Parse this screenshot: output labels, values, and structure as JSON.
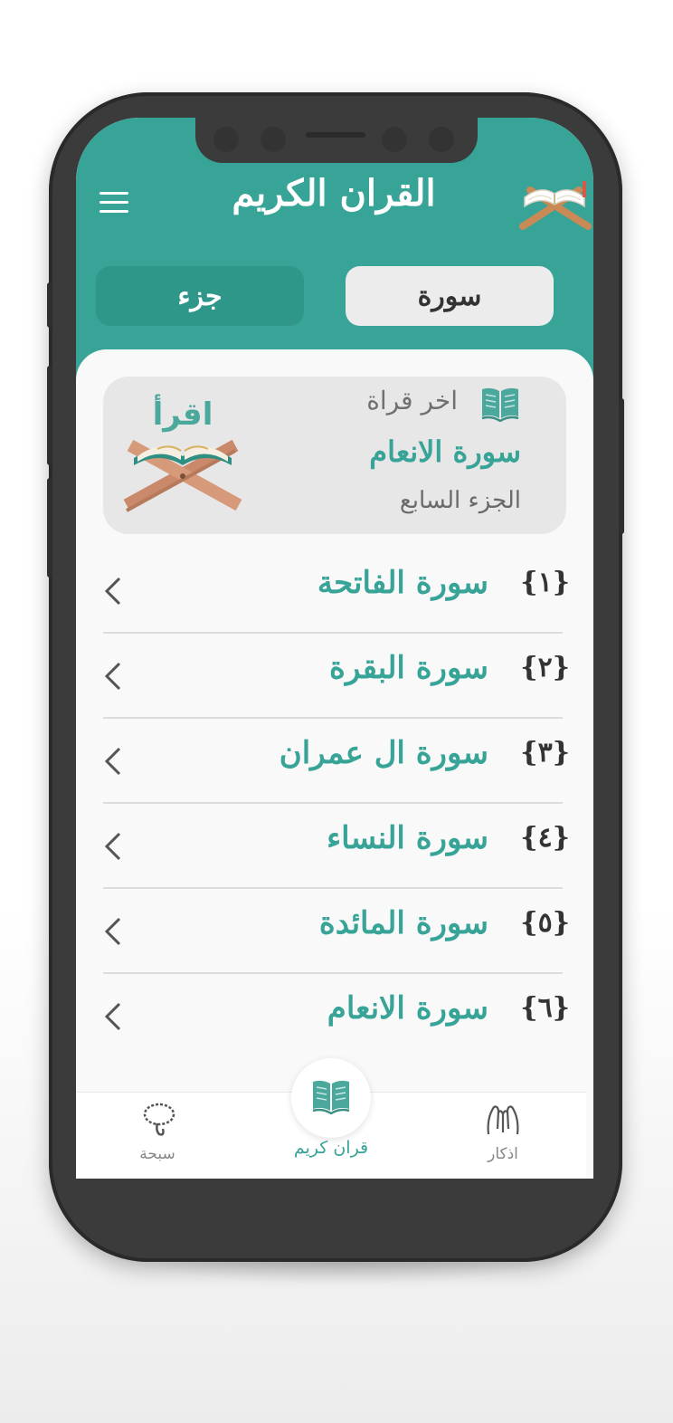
{
  "header": {
    "title": "القران الكريم",
    "menu_icon": "hamburger-menu-icon",
    "logo_icon": "quran-book-stand-icon"
  },
  "tabs": {
    "surah_label": "سورة",
    "juz_label": "جزء"
  },
  "last_read": {
    "label": "اخر قراة",
    "icon": "open-book-icon",
    "surah": "سورة الانعام",
    "juz": "الجزء السابع",
    "art_text": "اقرأ"
  },
  "surahs": [
    {
      "number": "{١}",
      "name": "سورة الفاتحة"
    },
    {
      "number": "{٢}",
      "name": "سورة البقرة"
    },
    {
      "number": "{٣}",
      "name": "سورة ال عمران"
    },
    {
      "number": "{٤}",
      "name": "سورة النساء"
    },
    {
      "number": "{٥}",
      "name": "سورة المائدة"
    },
    {
      "number": "{٦}",
      "name": "سورة الانعام"
    }
  ],
  "bottom_nav": {
    "left_label": "سبحة",
    "center_label": "قران كريم",
    "right_label": "اذكار"
  },
  "colors": {
    "primary": "#37a497",
    "primary_dark": "#2f968a",
    "phone_body": "#3b3b3b"
  }
}
